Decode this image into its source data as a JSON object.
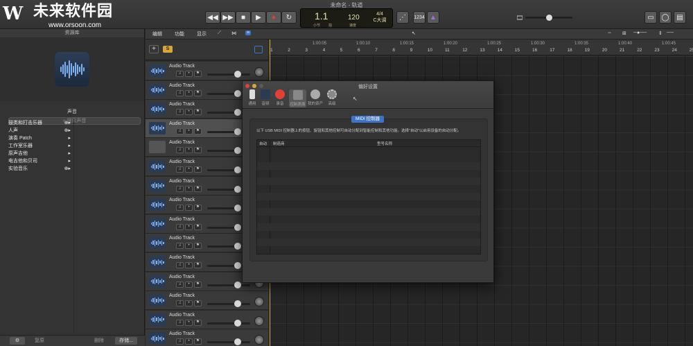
{
  "window": {
    "title": "未命名 - 轨道"
  },
  "watermark": {
    "text": "未来软件园",
    "url": "www.orsoon.com",
    "logo": "orsoon-logo"
  },
  "control_bar": {
    "rewind": "◀◀",
    "forward": "▶▶",
    "stop": "■",
    "play": "▶",
    "record": "●",
    "cycle": "↻",
    "lcd": {
      "bar": "1.1",
      "tempo": "120",
      "signature": "4/4",
      "key": "C大调",
      "sub_labels": [
        "小节",
        "拍",
        "速度"
      ]
    },
    "count_in": "1234"
  },
  "library": {
    "header": "资源库",
    "category": "声音",
    "search_placeholder": "搜索声音",
    "items": [
      {
        "label": "鼓类和打击乐器",
        "has_add": true
      },
      {
        "label": "人声",
        "has_add": true
      },
      {
        "label": "演奏 Patch",
        "has_add": false
      },
      {
        "label": "工作室乐器",
        "has_add": false
      },
      {
        "label": "原声吉他",
        "has_add": false
      },
      {
        "label": "电吉他和贝司",
        "has_add": false
      },
      {
        "label": "实验音乐",
        "has_add": true
      }
    ],
    "footer": {
      "gear": "⚙",
      "revert": "复原",
      "delete": "删除",
      "save": "存储..."
    }
  },
  "tracks_toolbar": {
    "menus": [
      "编辑",
      "功能",
      "显示"
    ]
  },
  "tracks": [
    {
      "name": "Audio Track"
    },
    {
      "name": "Audio Track"
    },
    {
      "name": "Audio Track"
    },
    {
      "name": "Audio Track"
    },
    {
      "name": "Audio Track"
    },
    {
      "name": "Audio Track"
    },
    {
      "name": "Audio Track"
    },
    {
      "name": "Audio Track"
    },
    {
      "name": "Audio Track"
    },
    {
      "name": "Audio Track"
    },
    {
      "name": "Audio Track"
    },
    {
      "name": "Audio Track"
    },
    {
      "name": "Audio Track"
    },
    {
      "name": "Audio Track"
    },
    {
      "name": "Audio Track"
    }
  ],
  "ruler": {
    "bars": [
      "1",
      "2",
      "3",
      "4",
      "5",
      "6",
      "7",
      "8",
      "9",
      "10",
      "11",
      "12",
      "13",
      "14",
      "15",
      "16",
      "17",
      "18",
      "19",
      "20",
      "21",
      "22",
      "23",
      "24",
      "25"
    ],
    "times": [
      "1:00:05",
      "1:00:10",
      "1:00:15",
      "1:00:20",
      "1:00:25",
      "1:00:30",
      "1:00:35",
      "1:00:40",
      "1:00:45"
    ]
  },
  "dialog": {
    "title": "偏好设置",
    "tabs": [
      {
        "label": "通用",
        "icon": "switch-icon"
      },
      {
        "label": "音频",
        "icon": "waveform-icon"
      },
      {
        "label": "录音",
        "icon": "record-icon"
      },
      {
        "label": "控制表面",
        "icon": "midi-icon"
      },
      {
        "label": "我的资产",
        "icon": "account-icon"
      },
      {
        "label": "高级",
        "icon": "gear-icon"
      }
    ],
    "segment": "MIDI 控制器",
    "description": "以下 USB MIDI 控制器上的按钮、旋钮和其他控制可自动分配到智能控制和其他功能。选择\"自动\"以启用设备的自动分配。",
    "columns": [
      "自动",
      "制造商",
      "型号名称"
    ]
  },
  "colors": {
    "accent": "#3f73c8",
    "record": "#e0403a",
    "track_icon": "#7fb2f0",
    "playhead": "#d8b23c"
  }
}
